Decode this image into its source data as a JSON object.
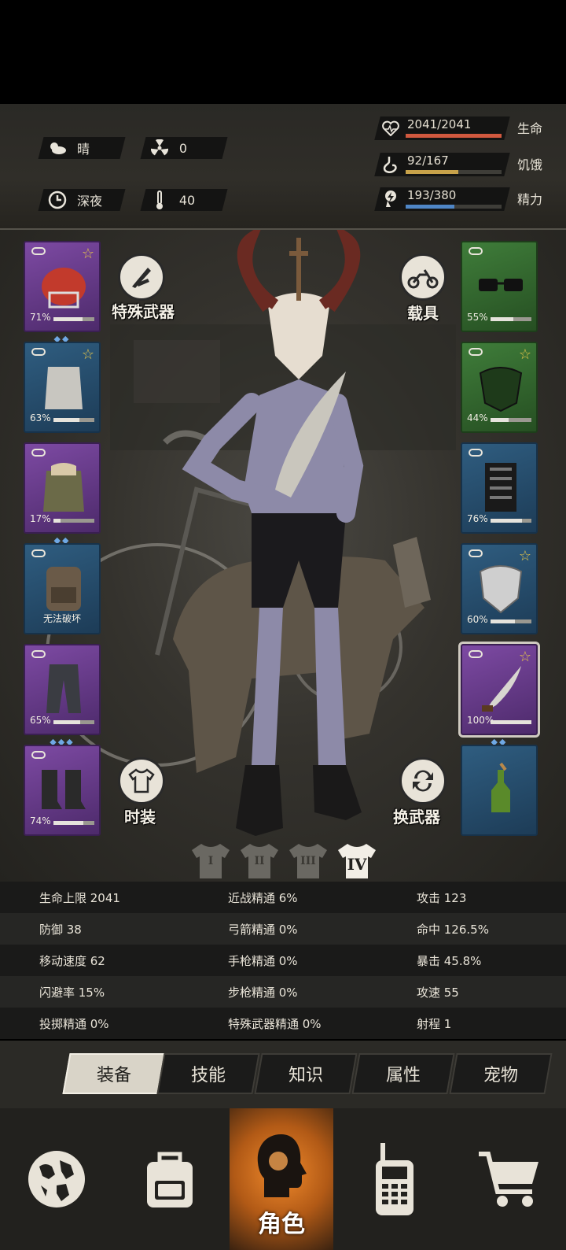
{
  "header": {
    "weather": "晴",
    "radiation": "0",
    "time_of_day": "深夜",
    "temperature": "40",
    "stats": [
      {
        "label": "生命",
        "value": "2041/2041",
        "fraction": 1.0,
        "color": "#d1593f",
        "icon": "heart-icon"
      },
      {
        "label": "饥饿",
        "value": "92/167",
        "fraction": 0.55,
        "color": "#c8a24a",
        "icon": "stomach-icon"
      },
      {
        "label": "精力",
        "value": "193/380",
        "fraction": 0.51,
        "color": "#4f86c6",
        "icon": "energy-icon"
      }
    ]
  },
  "equipment": {
    "left": [
      {
        "name": "helmet",
        "pct": "71%",
        "durability": 0.71,
        "rarity": "purple",
        "star": true,
        "gems": "◆◆"
      },
      {
        "name": "body",
        "pct": "63%",
        "durability": 0.63,
        "rarity": "blue",
        "star": true,
        "gems": ""
      },
      {
        "name": "coat",
        "pct": "17%",
        "durability": 0.17,
        "rarity": "purple",
        "star": false,
        "gems": "◆◆"
      },
      {
        "name": "backpack",
        "pct": "",
        "nobreak": "无法破坏",
        "rarity": "blue",
        "star": false,
        "gems": ""
      },
      {
        "name": "pants",
        "pct": "65%",
        "durability": 0.65,
        "rarity": "purple",
        "star": false,
        "gems": "◆◆◆"
      },
      {
        "name": "boots",
        "pct": "74%",
        "durability": 0.74,
        "rarity": "purple",
        "star": false,
        "gems": ""
      }
    ],
    "right": [
      {
        "name": "glasses",
        "pct": "55%",
        "durability": 0.55,
        "rarity": "green",
        "star": false,
        "gems": ""
      },
      {
        "name": "mask",
        "pct": "44%",
        "durability": 0.44,
        "rarity": "green",
        "star": true,
        "gems": ""
      },
      {
        "name": "vest",
        "pct": "76%",
        "durability": 0.76,
        "rarity": "blue",
        "star": false,
        "gems": ""
      },
      {
        "name": "shield",
        "pct": "60%",
        "durability": 0.6,
        "rarity": "blue",
        "star": true,
        "gems": ""
      },
      {
        "name": "machete",
        "pct": "100%",
        "durability": 1.0,
        "rarity": "purple",
        "star": true,
        "gems": "◆◆"
      },
      {
        "name": "molotov",
        "pct": "",
        "rarity": "blue",
        "star": false,
        "gems": ""
      }
    ],
    "buttons": {
      "special_weapon": "特殊武器",
      "vehicle": "载具",
      "fashion": "时装",
      "switch_weapon": "换武器"
    },
    "outfits": [
      "I",
      "II",
      "III",
      "IV"
    ]
  },
  "attributes": [
    [
      "生命上限 2041",
      "近战精通 6%",
      "攻击 123"
    ],
    [
      "防御 38",
      "弓箭精通 0%",
      "命中 126.5%"
    ],
    [
      "移动速度 62",
      "手枪精通 0%",
      "暴击 45.8%"
    ],
    [
      "闪避率 15%",
      "步枪精通 0%",
      "攻速 55"
    ],
    [
      "投掷精通 0%",
      "特殊武器精通 0%",
      "射程 1"
    ]
  ],
  "tabs": [
    "装备",
    "技能",
    "知识",
    "属性",
    "宠物"
  ],
  "nav": {
    "character_label": "角色"
  }
}
